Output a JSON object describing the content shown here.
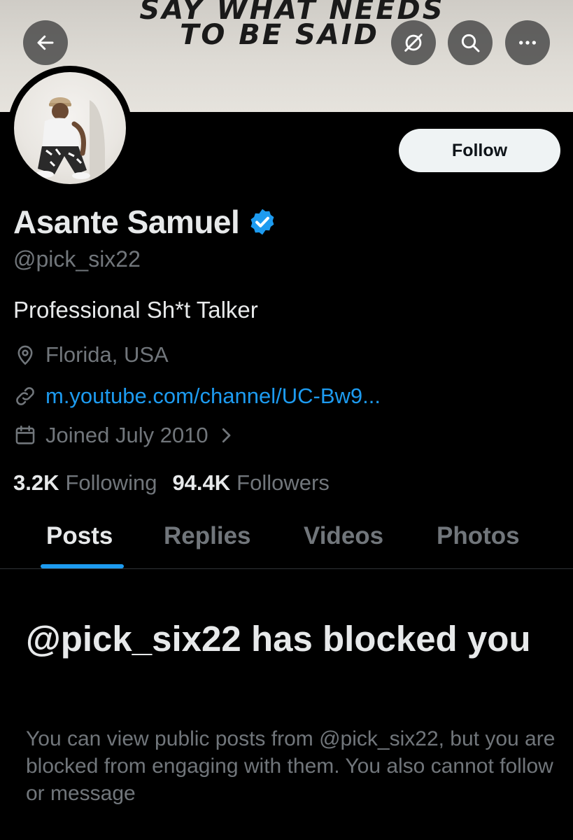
{
  "banner": {
    "line1": "SAY WHAT NEEDS",
    "line2": "TO BE SAID"
  },
  "header": {
    "back_icon": "back-arrow-icon",
    "mute_icon": "mute-icon",
    "search_icon": "search-icon",
    "more_icon": "more-icon"
  },
  "profile": {
    "name": "Asante Samuel",
    "handle": "@pick_six22",
    "bio": "Professional Sh*t Talker",
    "location": "Florida, USA",
    "link": "m.youtube.com/channel/UC-Bw9...",
    "joined": "Joined July 2010",
    "verified": true
  },
  "follow_button": {
    "label": "Follow"
  },
  "stats": {
    "following_count": "3.2K",
    "following_label": "Following",
    "followers_count": "94.4K",
    "followers_label": "Followers"
  },
  "tabs": [
    {
      "label": "Posts",
      "active": true
    },
    {
      "label": "Replies",
      "active": false
    },
    {
      "label": "Videos",
      "active": false
    },
    {
      "label": "Photos",
      "active": false
    }
  ],
  "blocked": {
    "title": "@pick_six22 has blocked you",
    "description": "You can view public posts from @pick_six22, but you are blocked from engaging with them. You also cannot follow or message"
  },
  "colors": {
    "background": "#000000",
    "accent": "#1d9bf0",
    "text_primary": "#e7e9ea",
    "text_secondary": "#71767b"
  }
}
